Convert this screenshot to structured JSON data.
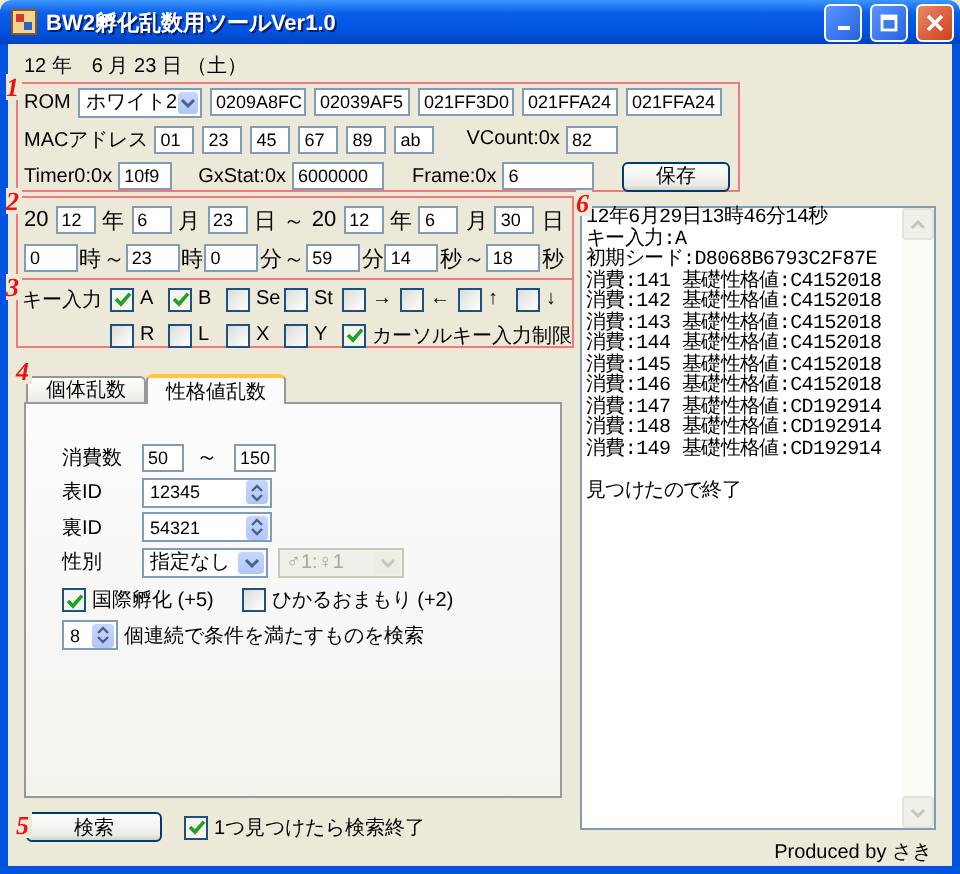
{
  "window": {
    "title": "BW2孵化乱数用ツールVer1.0"
  },
  "date_line": "12 年　6 月 23 日 （土）",
  "rom_section": {
    "marker": "1",
    "rom_label": "ROM",
    "rom_select": "ホワイト2",
    "addresses": [
      "0209A8FC",
      "02039AF5",
      "021FF3D0",
      "021FFA24",
      "021FFA24"
    ],
    "mac_label": "MACアドレス",
    "mac": [
      "01",
      "23",
      "45",
      "67",
      "89",
      "ab"
    ],
    "vcount_label": "VCount:0x",
    "vcount": "82",
    "timer0_label": "Timer0:0x",
    "timer0": "10f9",
    "gxstat_label": "GxStat:0x",
    "gxstat": "6000000",
    "frame_label": "Frame:0x",
    "frame": "6",
    "save_button": "保存"
  },
  "date_range": {
    "marker": "2",
    "rows": [
      [
        {
          "kind": "label",
          "text": "20"
        },
        {
          "kind": "field",
          "value": "12"
        },
        {
          "kind": "label",
          "text": "年"
        },
        {
          "kind": "field",
          "value": "6"
        },
        {
          "kind": "label",
          "text": "月"
        },
        {
          "kind": "field",
          "value": "23"
        },
        {
          "kind": "label",
          "text": "日"
        },
        {
          "kind": "label",
          "text": "～"
        },
        {
          "kind": "label",
          "text": "20"
        },
        {
          "kind": "field",
          "value": "12"
        },
        {
          "kind": "label",
          "text": "年"
        },
        {
          "kind": "field",
          "value": "6"
        },
        {
          "kind": "label",
          "text": "月"
        },
        {
          "kind": "field",
          "value": "30"
        },
        {
          "kind": "label",
          "text": "日"
        }
      ],
      [
        {
          "kind": "field",
          "value": "0"
        },
        {
          "kind": "label",
          "text": "時"
        },
        {
          "kind": "label",
          "text": "～"
        },
        {
          "kind": "field",
          "value": "23"
        },
        {
          "kind": "label",
          "text": "時"
        },
        {
          "kind": "field",
          "value": "0"
        },
        {
          "kind": "label",
          "text": "分"
        },
        {
          "kind": "label",
          "text": "～"
        },
        {
          "kind": "field",
          "value": "59"
        },
        {
          "kind": "label",
          "text": "分"
        },
        {
          "kind": "field",
          "value": "14"
        },
        {
          "kind": "label",
          "text": "秒"
        },
        {
          "kind": "label",
          "text": "～"
        },
        {
          "kind": "field",
          "value": "18"
        },
        {
          "kind": "label",
          "text": "秒"
        }
      ]
    ]
  },
  "key_input": {
    "marker": "3",
    "label": "キー入力",
    "rows": [
      [
        {
          "label": "A",
          "checked": true
        },
        {
          "label": "B",
          "checked": true
        },
        {
          "label": "Se",
          "checked": false
        },
        {
          "label": "St",
          "checked": false
        },
        {
          "label": "→",
          "checked": false
        },
        {
          "label": "←",
          "checked": false
        },
        {
          "label": "↑",
          "checked": false
        },
        {
          "label": "↓",
          "checked": false
        }
      ],
      [
        {
          "label": "R",
          "checked": false
        },
        {
          "label": "L",
          "checked": false
        },
        {
          "label": "X",
          "checked": false
        },
        {
          "label": "Y",
          "checked": false
        },
        {
          "label": "カーソルキー入力制限",
          "checked": true
        }
      ]
    ]
  },
  "tabs": {
    "marker": "4",
    "items": [
      {
        "label": "個体乱数",
        "selected": false
      },
      {
        "label": "性格値乱数",
        "selected": true
      }
    ]
  },
  "nature_panel": {
    "consumption_label": "消費数",
    "consumption_from": "50",
    "range_sep": "～",
    "consumption_to": "150",
    "tid_label": "表ID",
    "tid": "12345",
    "sid_label": "裏ID",
    "sid": "54321",
    "gender_label": "性別",
    "gender_select": "指定なし",
    "ratio_select": {
      "value": "♂1:♀1",
      "disabled": true
    },
    "options": [
      {
        "label": "国際孵化 (+5)",
        "checked": true
      },
      {
        "label": "ひかるおまもり (+2)",
        "checked": false
      }
    ],
    "consecutive": "8",
    "consecutive_label": "個連続で条件を満たすものを検索"
  },
  "search": {
    "marker": "5",
    "button": "検索",
    "stop_option": {
      "label": "1つ見つけたら検索終了",
      "checked": true
    }
  },
  "log": {
    "marker": "6",
    "lines": [
      "12年6月29日13時46分14秒",
      "キー入力:A",
      "初期シード:D8068B6793C2F87E",
      "消費:141 基礎性格値:C4152018",
      "消費:142 基礎性格値:C4152018",
      "消費:143 基礎性格値:C4152018",
      "消費:144 基礎性格値:C4152018",
      "消費:145 基礎性格値:C4152018",
      "消費:146 基礎性格値:C4152018",
      "消費:147 基礎性格値:CD192914",
      "消費:148 基礎性格値:CD192914",
      "消費:149 基礎性格値:CD192914"
    ],
    "final_message": "見つけたので終了"
  },
  "footer": "Produced by さき"
}
